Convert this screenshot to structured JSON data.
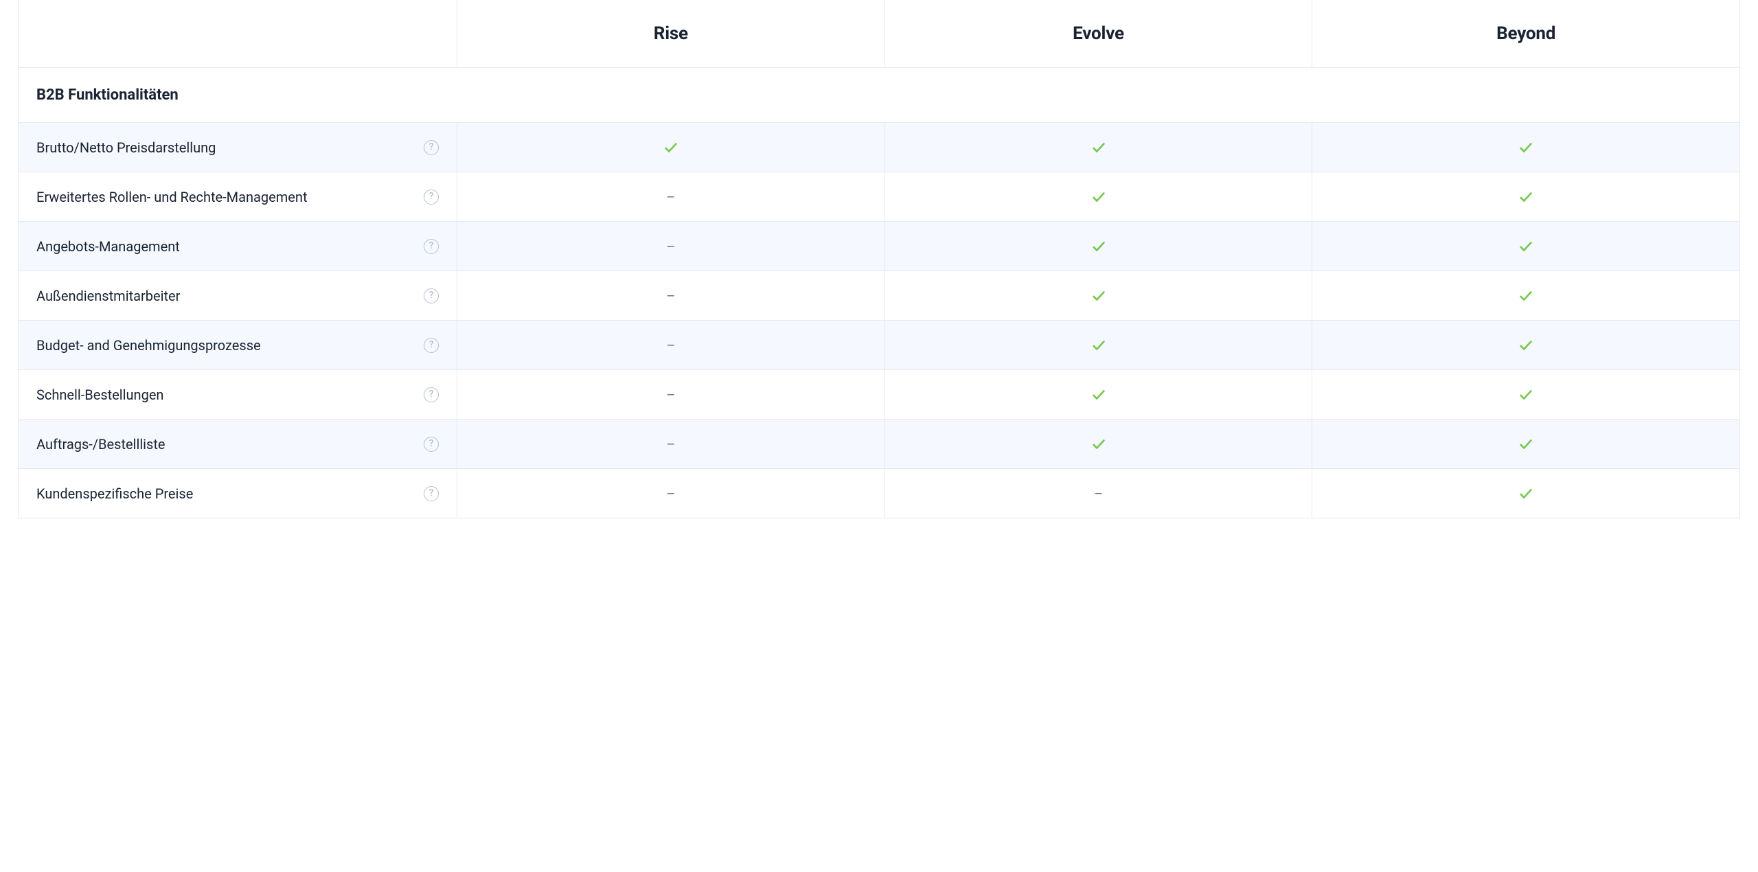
{
  "plans": [
    "Rise",
    "Evolve",
    "Beyond"
  ],
  "section_title": "B2B Funktionalitäten",
  "help_glyph": "?",
  "dash_glyph": "–",
  "features": [
    {
      "label": "Brutto/Netto Preisdarstellung",
      "values": [
        "check",
        "check",
        "check"
      ],
      "striped": true
    },
    {
      "label": "Erweitertes Rollen- und Rechte-Management",
      "values": [
        "dash",
        "check",
        "check"
      ],
      "striped": false
    },
    {
      "label": "Angebots-Management",
      "values": [
        "dash",
        "check",
        "check"
      ],
      "striped": true
    },
    {
      "label": "Außendienstmitarbeiter",
      "values": [
        "dash",
        "check",
        "check"
      ],
      "striped": false
    },
    {
      "label": "Budget- and Genehmigungsprozesse",
      "values": [
        "dash",
        "check",
        "check"
      ],
      "striped": true
    },
    {
      "label": "Schnell-Bestellungen",
      "values": [
        "dash",
        "check",
        "check"
      ],
      "striped": false
    },
    {
      "label": "Auftrags-/Bestellliste",
      "values": [
        "dash",
        "check",
        "check"
      ],
      "striped": true
    },
    {
      "label": "Kundenspezifische Preise",
      "values": [
        "dash",
        "dash",
        "check"
      ],
      "striped": false
    }
  ]
}
